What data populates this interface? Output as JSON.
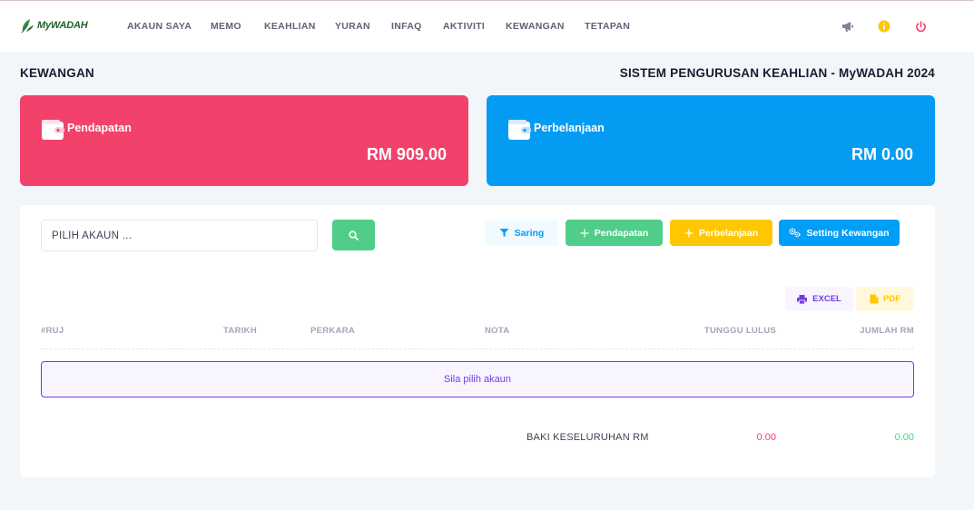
{
  "brand": {
    "name": "MyWADAH",
    "color": "#1f5f2a"
  },
  "nav": {
    "items": [
      {
        "label": "AKAUN SAYA"
      },
      {
        "label": "MEMO"
      },
      {
        "label": "KEAHLIAN"
      },
      {
        "label": "YURAN"
      },
      {
        "label": "INFAQ"
      },
      {
        "label": "AKTIVITI"
      },
      {
        "label": "KEWANGAN"
      },
      {
        "label": "TETAPAN"
      }
    ],
    "icons": [
      "megaphone-icon",
      "info-icon",
      "power-icon"
    ]
  },
  "page": {
    "title": "KEWANGAN",
    "system_title": "SISTEM PENGURUSAN KEAHLIAN - MyWADAH 2024"
  },
  "cards": {
    "income": {
      "label": "Pendapatan",
      "amount": "RM 909.00",
      "color": "#f2416b"
    },
    "expense": {
      "label": "Perbelanjaan",
      "amount": "RM 0.00",
      "color": "#049cf3"
    }
  },
  "search": {
    "placeholder": "PILIH AKAUN ...",
    "value": ""
  },
  "actions": {
    "filter": "Saring",
    "add_income": "Pendapatan",
    "add_expense": "Perbelanjaan",
    "settings": "Setting Kewangan"
  },
  "export": {
    "excel": "EXCEL",
    "pdf": "PDF"
  },
  "table": {
    "columns": [
      "#RUJ",
      "TARIKH",
      "PERKARA",
      "NOTA",
      "TUNGGU LULUS",
      "JUMLAH RM"
    ],
    "empty_message": "Sila pilih akaun"
  },
  "totals": {
    "label": "BAKI KESELURUHAN RM",
    "pending": "0.00",
    "amount": "0.00"
  }
}
